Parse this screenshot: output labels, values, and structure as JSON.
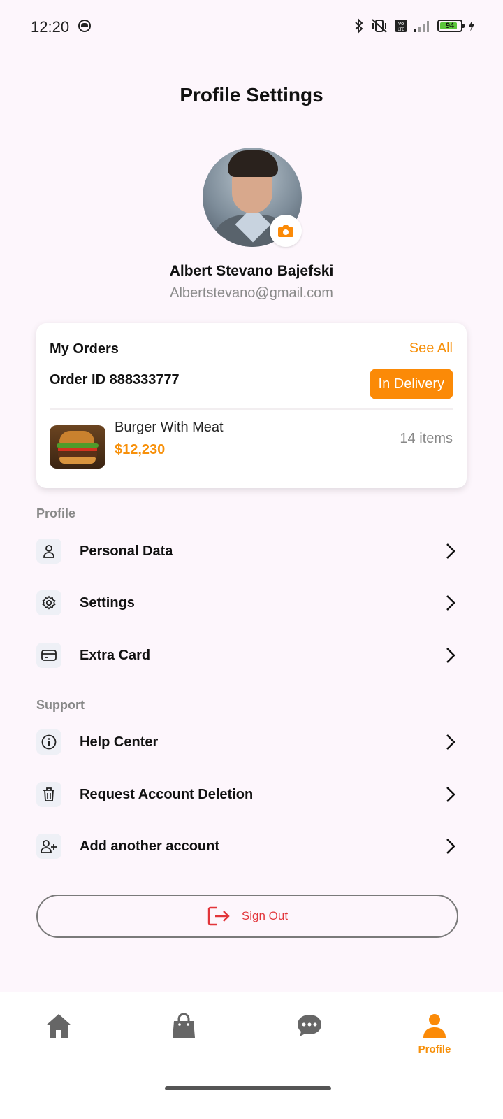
{
  "status_bar": {
    "time": "12:20",
    "battery": "94"
  },
  "header": {
    "title": "Profile Settings"
  },
  "user": {
    "name": "Albert Stevano Bajefski",
    "email": "Albertstevano@gmail.com"
  },
  "orders": {
    "title": "My Orders",
    "see_all": "See All",
    "order_id": "Order ID 888333777",
    "status": "In Delivery",
    "item": {
      "name": "Burger With Meat",
      "price": "$12,230",
      "count": "14 items"
    }
  },
  "profile_section": {
    "label": "Profile",
    "items": [
      {
        "label": "Personal Data",
        "icon": "user-icon"
      },
      {
        "label": "Settings",
        "icon": "gear-icon"
      },
      {
        "label": "Extra Card",
        "icon": "card-icon"
      }
    ]
  },
  "support_section": {
    "label": "Support",
    "items": [
      {
        "label": "Help Center",
        "icon": "info-icon"
      },
      {
        "label": "Request Account Deletion",
        "icon": "trash-icon"
      },
      {
        "label": "Add another account",
        "icon": "user-plus-icon"
      }
    ]
  },
  "signout": {
    "label": "Sign Out"
  },
  "bottom_nav": {
    "items": [
      {
        "icon": "home-icon"
      },
      {
        "icon": "bag-icon"
      },
      {
        "icon": "chat-icon"
      },
      {
        "icon": "profile-icon",
        "label": "Profile",
        "active": true
      }
    ]
  },
  "colors": {
    "accent": "#fb8a07",
    "danger": "#e2353a",
    "background": "#fdf6fc"
  }
}
